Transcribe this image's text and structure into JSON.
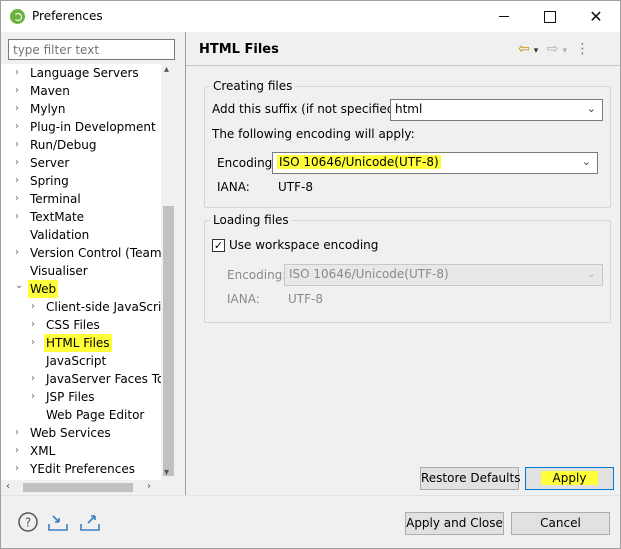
{
  "window": {
    "title": "Preferences"
  },
  "filter": {
    "placeholder": "type filter text"
  },
  "tree": {
    "items": [
      {
        "label": "Language Servers",
        "expander": "›"
      },
      {
        "label": "Maven",
        "expander": "›"
      },
      {
        "label": "Mylyn",
        "expander": "›"
      },
      {
        "label": "Plug-in Development",
        "expander": "›"
      },
      {
        "label": "Run/Debug",
        "expander": "›"
      },
      {
        "label": "Server",
        "expander": "›"
      },
      {
        "label": "Spring",
        "expander": "›"
      },
      {
        "label": "Terminal",
        "expander": "›"
      },
      {
        "label": "TextMate",
        "expander": "›"
      },
      {
        "label": "Validation",
        "expander": ""
      },
      {
        "label": "Version Control (Team)",
        "expander": "›"
      },
      {
        "label": "Visualiser",
        "expander": ""
      },
      {
        "label": "Web",
        "expander": "⌄"
      },
      {
        "label": "Client-side JavaScript",
        "expander": "›"
      },
      {
        "label": "CSS Files",
        "expander": "›"
      },
      {
        "label": "HTML Files",
        "expander": "›"
      },
      {
        "label": "JavaScript",
        "expander": ""
      },
      {
        "label": "JavaServer Faces Tools",
        "expander": "›"
      },
      {
        "label": "JSP Files",
        "expander": "›"
      },
      {
        "label": "Web Page Editor",
        "expander": ""
      },
      {
        "label": "Web Services",
        "expander": "›"
      },
      {
        "label": "XML",
        "expander": "›"
      },
      {
        "label": "YEdit Preferences",
        "expander": "›"
      }
    ]
  },
  "page": {
    "title": "HTML Files",
    "creating": {
      "group_title": "Creating files",
      "suffix_label": "Add this suffix (if not specified):",
      "suffix_value": "html",
      "encoding_note": "The following encoding will apply:",
      "encoding_label": "Encoding:",
      "encoding_value": "ISO 10646/Unicode(UTF-8)",
      "iana_label": "IANA:",
      "iana_value": "UTF-8"
    },
    "loading": {
      "group_title": "Loading files",
      "workspace_label": "Use workspace encoding",
      "workspace_checked": true,
      "encoding_label": "Encoding:",
      "encoding_value": "ISO 10646/Unicode(UTF-8)",
      "iana_label": "IANA:",
      "iana_value": "UTF-8"
    }
  },
  "buttons": {
    "restore_defaults": "Restore Defaults",
    "apply": "Apply",
    "apply_and_close": "Apply and Close",
    "cancel": "Cancel"
  },
  "highlight_color": "#ffff3a"
}
